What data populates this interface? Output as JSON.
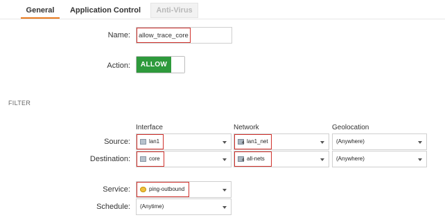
{
  "tabs": [
    {
      "label": "General"
    },
    {
      "label": "Application Control"
    },
    {
      "label": "Anti-Virus"
    }
  ],
  "form": {
    "name_label": "Name:",
    "name_value": "allow_trace_core",
    "action_label": "Action:",
    "action_value": "ALLOW"
  },
  "filter": {
    "section_title": "FILTER",
    "col_interface": "Interface",
    "col_network": "Network",
    "col_geolocation": "Geolocation",
    "source_label": "Source:",
    "destination_label": "Destination:",
    "source": {
      "interface": "lan1",
      "network": "lan1_net",
      "geolocation": "(Anywhere)"
    },
    "destination": {
      "interface": "core",
      "network": "all-nets",
      "geolocation": "(Anywhere)"
    }
  },
  "service": {
    "service_label": "Service:",
    "service_value": "ping-outbound",
    "schedule_label": "Schedule:",
    "schedule_value": "(Anytime)"
  },
  "colors": {
    "accent": "#e87a1e",
    "allow_green": "#2e9a3c",
    "highlight_red": "#d0302b"
  }
}
